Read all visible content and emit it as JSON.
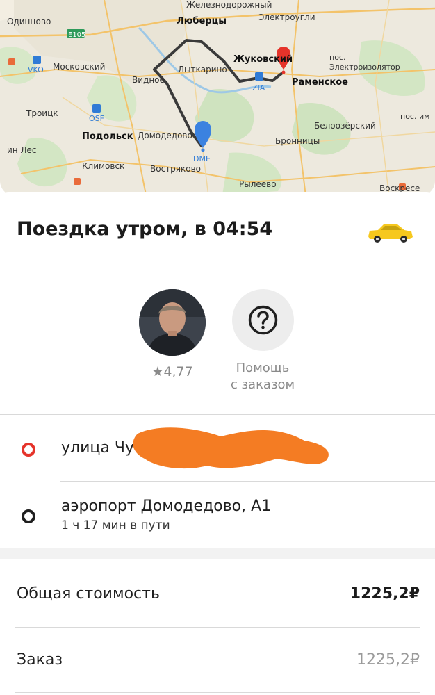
{
  "map": {
    "places": {
      "zheleznodorozhny": "Железнодорожный",
      "elektrougli": "Электроугли",
      "odintsovo": "Одинцово",
      "lyubertsy": "Люберцы",
      "e105": "E105",
      "vko": "VKO",
      "moskovsky": "Московский",
      "vidnoe": "Видное",
      "lytkarino": "Лыткарино",
      "zhukovsky": "Жуковский",
      "zia": "ZIA",
      "ramenskoe": "Раменское",
      "pos_elektroizolyator": "пос. Электроизолятор",
      "troitsk": "Троицк",
      "osf": "OSF",
      "podolsk": "Подольск",
      "domodedovo": "Домодедово",
      "dme": "DME",
      "beloozersky": "Белоозёрский",
      "pos_im": "пос. им",
      "in_les": "ин Лес",
      "bronnitsy": "Бронницы",
      "klimovsk": "Климовск",
      "vostryakovo": "Востряково",
      "ryleevo": "Рылеево",
      "voskresensk": "Воскресе"
    },
    "route_color": "#3a3a3a",
    "start_pin_color": "#e5332a",
    "end_pin_color": "#3b82e0"
  },
  "trip": {
    "title": "Поездка утром, в 04:54",
    "vehicle_icon": "taxi-car-icon"
  },
  "driver": {
    "rating": "★4,77"
  },
  "help": {
    "icon": "question-circle-icon",
    "label_line1": "Помощь",
    "label_line2": "с заказом"
  },
  "route": {
    "from": "улица Чу",
    "to": "аэропорт Домодедово, А1",
    "duration": "1 ч 17 мин в пути",
    "from_color": "#e5332a",
    "to_color": "#1f1f1f"
  },
  "costs": {
    "total_label": "Общая стоимость",
    "total_value": "1225,2₽",
    "order_label": "Заказ",
    "order_value": "1225,2₽"
  }
}
